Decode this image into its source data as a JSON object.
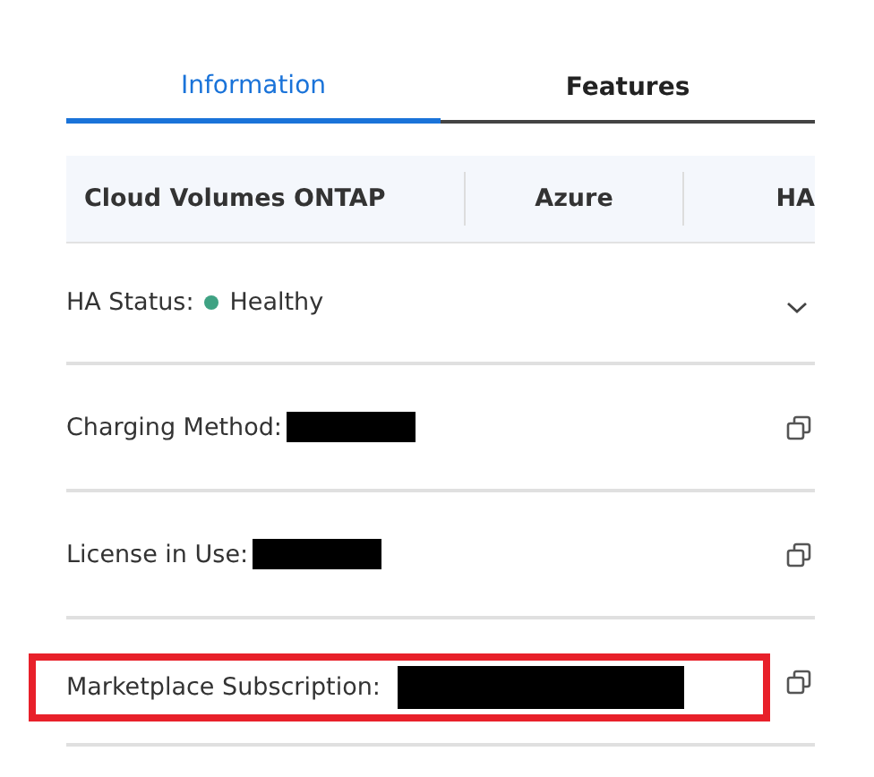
{
  "tabs": [
    {
      "label": "Information",
      "selected": true
    },
    {
      "label": "Features",
      "selected": false
    }
  ],
  "summary": [
    "Cloud Volumes ONTAP",
    "Azure",
    "HA"
  ],
  "rows": [
    {
      "kind": "status",
      "label": "HA Status:",
      "value": "Healthy",
      "color": "#3fa283",
      "expanded": false,
      "highlighted": false
    },
    {
      "kind": "copy",
      "label": "Charging Method:",
      "redacted": true,
      "highlighted": false
    },
    {
      "kind": "copy",
      "label": "License in Use:",
      "redacted": true,
      "highlighted": false
    },
    {
      "kind": "copy",
      "label": "Marketplace Subscription:",
      "redacted": true,
      "highlighted": true
    }
  ]
}
